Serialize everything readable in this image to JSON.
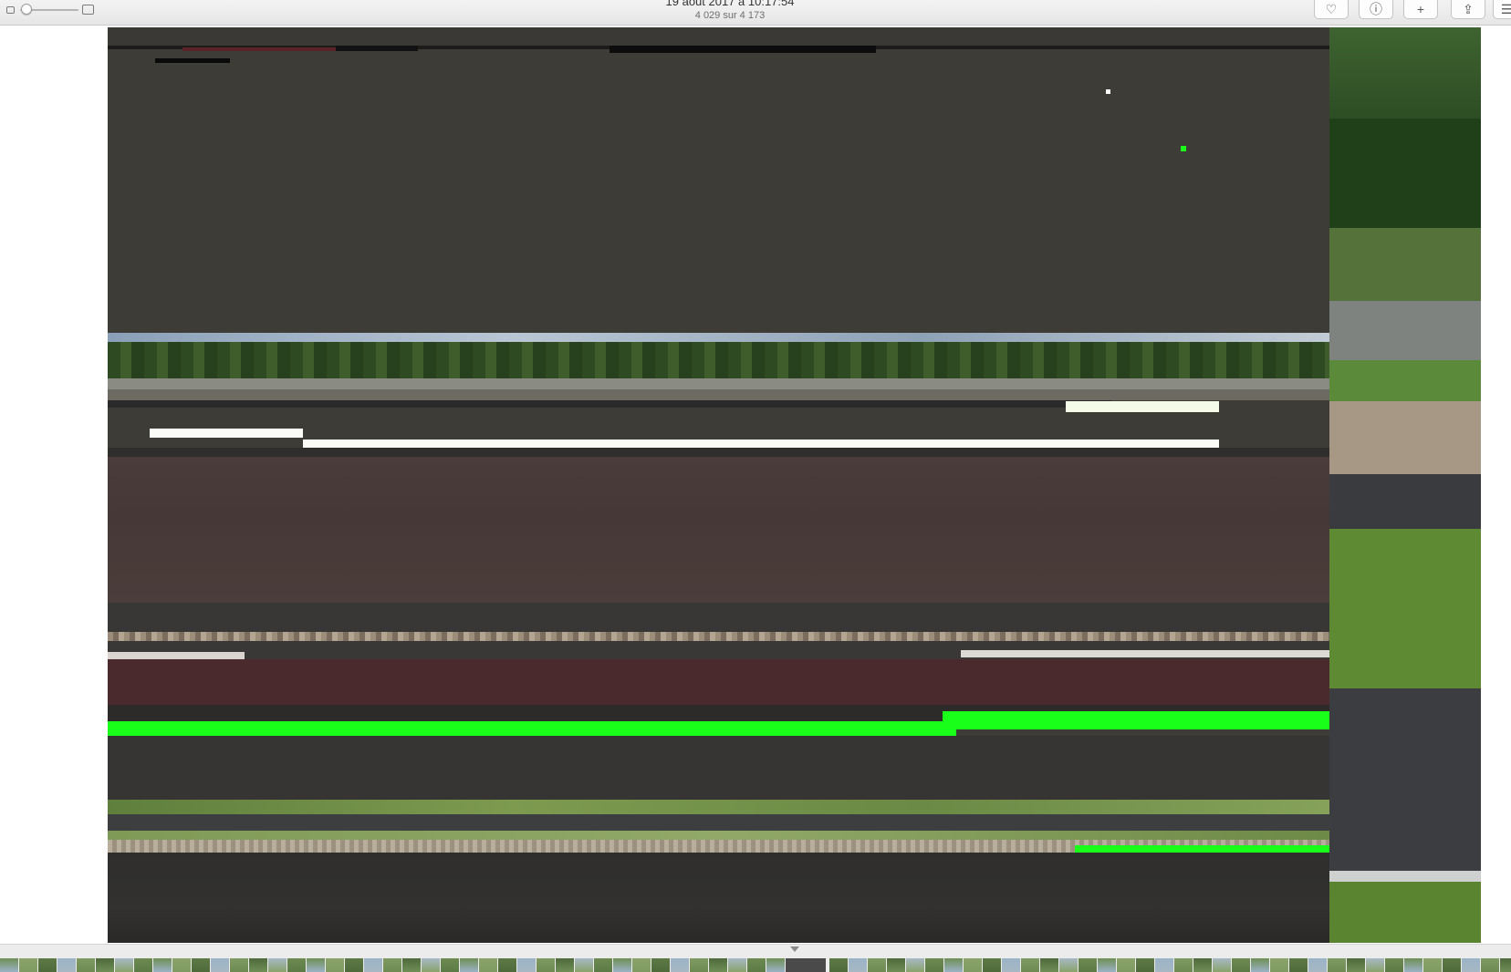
{
  "toolbar": {
    "title": "19 août 2017 à 10:17:54",
    "subtitle": "4 029 sur 4 173",
    "zoom": {
      "level": 0.0
    },
    "buttons": [
      {
        "name": "favorite-button",
        "icon": "heart-icon",
        "glyph": "♡"
      },
      {
        "name": "info-button",
        "icon": "info-icon",
        "glyph": "ⓘ"
      },
      {
        "name": "add-button",
        "icon": "plus-icon",
        "glyph": "+"
      },
      {
        "name": "share-button",
        "icon": "share-icon",
        "glyph": "⇪"
      },
      {
        "name": "sidebar-button",
        "icon": "sidebar-icon",
        "glyph": "☰"
      }
    ]
  },
  "photo": {
    "description_colors": {
      "glitch_gray": "#3e3c37",
      "glitch_maroon": "#4a2a2c",
      "glitch_green": "#19ff19",
      "grass": "#6f8f46",
      "asphalt": "#3a3b3e",
      "gravel": "#9c8d7a"
    }
  },
  "filmstrip": {
    "current_index_indicator": "chevron-down-icon"
  }
}
